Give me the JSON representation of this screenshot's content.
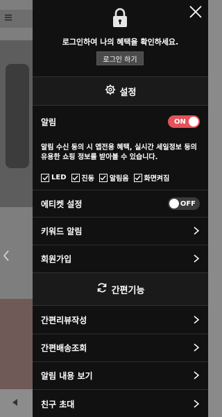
{
  "background": {
    "menu_icon": "hamburger-icon",
    "prev_arrow_icon": "chevron-left-icon",
    "back_icon": "triangle-left-icon"
  },
  "drawer": {
    "lock_icon": "lock-icon",
    "close_icon": "close-icon",
    "login_message": "로그인하여 나의 혜택을 확인하세요.",
    "login_button": "로그인 하기",
    "settings_title": "설정",
    "settings_icon": "gear-icon",
    "alarm": {
      "label": "알림",
      "state": "ON",
      "description": "알림 수신 동의 시 앱전용 혜택, 실시간 세일정보 등의 유용한 쇼핑 정보를 받아볼 수 있습니다.",
      "options": [
        {
          "label": "LED",
          "checked": true
        },
        {
          "label": "진동",
          "checked": true
        },
        {
          "label": "알림음",
          "checked": true
        },
        {
          "label": "화면켜짐",
          "checked": true
        }
      ]
    },
    "etiquette": {
      "label": "에티켓 설정",
      "state": "OFF"
    },
    "menu_items": [
      {
        "label": "키워드 알림"
      },
      {
        "label": "회원가입"
      }
    ],
    "quick_title": "간편기능",
    "quick_icon": "refresh-icon",
    "quick_items": [
      {
        "label": "간편리뷰작성"
      },
      {
        "label": "간편배송조회"
      },
      {
        "label": "알림 내용 보기"
      },
      {
        "label": "친구 초대"
      }
    ],
    "colors": {
      "toggle_on": "#e3535b",
      "toggle_off": "#3b3b3b",
      "panel": "#111111"
    }
  }
}
